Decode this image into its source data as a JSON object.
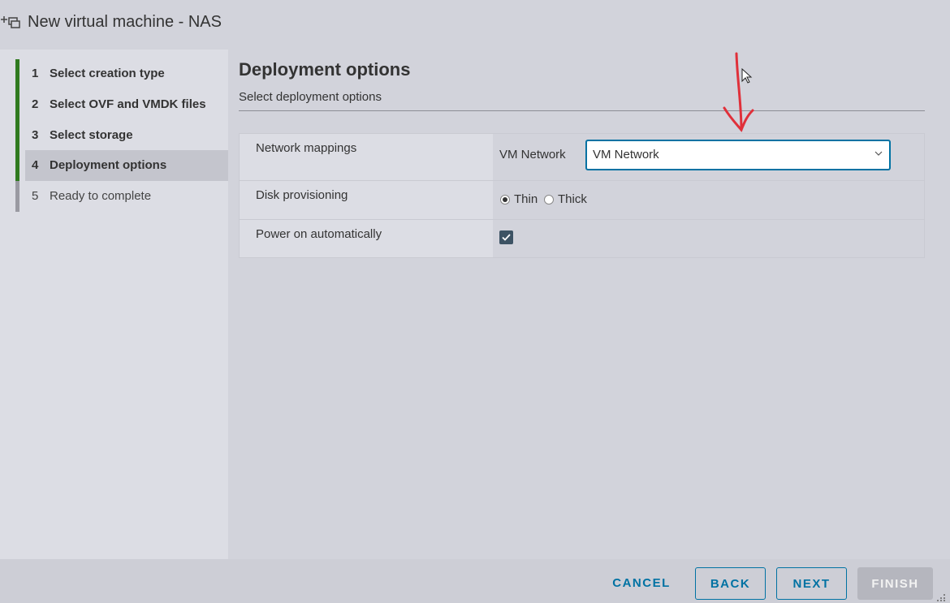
{
  "window": {
    "title": "New virtual machine - NAS",
    "icon": "add-vm-icon"
  },
  "sidebar": {
    "steps": [
      {
        "num": "1",
        "label": "Select creation type",
        "state": "done"
      },
      {
        "num": "2",
        "label": "Select OVF and VMDK files",
        "state": "done"
      },
      {
        "num": "3",
        "label": "Select storage",
        "state": "done"
      },
      {
        "num": "4",
        "label": "Deployment options",
        "state": "active"
      },
      {
        "num": "5",
        "label": "Ready to complete",
        "state": "todo"
      }
    ]
  },
  "main": {
    "heading": "Deployment options",
    "subheading": "Select deployment options",
    "rows": {
      "network": {
        "label": "Network mappings",
        "source": "VM Network",
        "selected": "VM Network"
      },
      "disk": {
        "label": "Disk provisioning",
        "options": [
          "Thin",
          "Thick"
        ],
        "selected": "Thin"
      },
      "power": {
        "label": "Power on automatically",
        "checked": true
      }
    }
  },
  "footer": {
    "cancel": "CANCEL",
    "back": "BACK",
    "next": "NEXT",
    "finish": "FINISH"
  },
  "colors": {
    "accent": "#0072a3",
    "step_done": "#2f7a1f",
    "step_todo": "#9a9aa2",
    "annotation": "#e0303a"
  }
}
